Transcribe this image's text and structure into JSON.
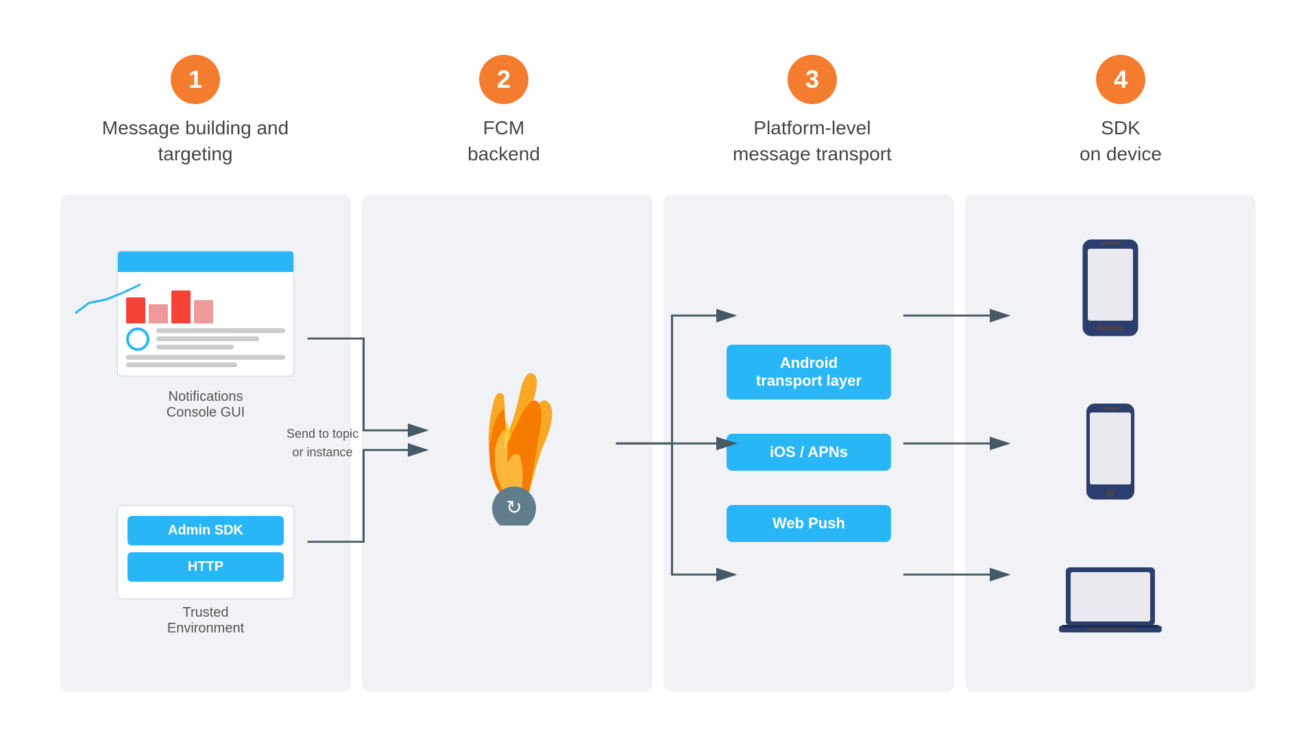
{
  "steps": [
    {
      "number": "1",
      "label": "Message building and\ntargeting"
    },
    {
      "number": "2",
      "label": "FCM\nbackend"
    },
    {
      "number": "3",
      "label": "Platform-level\nmessage transport"
    },
    {
      "number": "4",
      "label": "SDK\non device"
    }
  ],
  "col1": {
    "console_label": "Notifications\nConsole GUI",
    "trusted_label": "Trusted\nEnvironment",
    "admin_sdk_btn": "Admin SDK",
    "http_btn": "HTTP",
    "send_label": "Send to topic\nor instance"
  },
  "col3": {
    "transport_boxes": [
      "Android\ntransport layer",
      "iOS / APNs",
      "Web Push"
    ]
  },
  "colors": {
    "orange": "#f37c2f",
    "blue": "#29b6f6",
    "dark_blue": "#2c3e6e",
    "bg": "#f0f2f5",
    "arrow": "#455a64"
  }
}
